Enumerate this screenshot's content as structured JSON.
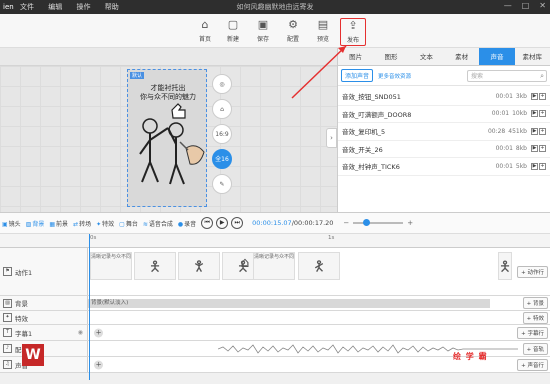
{
  "titlebar": {
    "logo": "ien",
    "menu": [
      "文件",
      "编辑",
      "操作",
      "帮助"
    ],
    "title": "如何风趣幽默地由远寄发",
    "controls": [
      "—",
      "□",
      "✕"
    ]
  },
  "toolbar": {
    "buttons": [
      {
        "label": "首页",
        "icon": "home-icon",
        "glyph": "⌂"
      },
      {
        "label": "新建",
        "icon": "new-file-icon",
        "glyph": "▢"
      },
      {
        "label": "保存",
        "icon": "save-icon",
        "glyph": "▣"
      },
      {
        "label": "配置",
        "icon": "settings-icon",
        "glyph": "⚙"
      },
      {
        "label": "预览",
        "icon": "preview-icon",
        "glyph": "▤"
      },
      {
        "label": "发布",
        "icon": "publish-icon",
        "glyph": "⇪"
      }
    ]
  },
  "canvas": {
    "tag": "默认",
    "headline_line1": "才能衬托出",
    "headline_line2": "你与众不同的魅力",
    "side_tools": [
      "◎",
      "⌂",
      "16:9",
      "全16",
      "✎"
    ]
  },
  "right_panel": {
    "tabs": [
      "图片",
      "图形",
      "文本",
      "素材",
      "声音",
      "素材库"
    ],
    "active_tab": 4,
    "add_label": "添加声音",
    "more_label": "更多音效资源",
    "search_placeholder": "搜索",
    "items": [
      {
        "name": "音效_按钮_SND051",
        "duration": "00:01",
        "size": "3kb"
      },
      {
        "name": "音效_叮满额声_DOOR8",
        "duration": "00:01",
        "size": "10kb"
      },
      {
        "name": "音效_复印机_5",
        "duration": "00:28",
        "size": "451kb"
      },
      {
        "name": "音效_开关_26",
        "duration": "00:01",
        "size": "8kb"
      },
      {
        "name": "音效_村钟声_TICK6",
        "duration": "00:01",
        "size": "5kb"
      }
    ]
  },
  "timeline_toolbar": {
    "tools": [
      {
        "label": "镜头",
        "glyph": "▣"
      },
      {
        "label": "背景",
        "glyph": "▨"
      },
      {
        "label": "前景",
        "glyph": "▦"
      },
      {
        "label": "转场",
        "glyph": "⇄"
      },
      {
        "label": "特效",
        "glyph": "✦"
      },
      {
        "label": "舞台",
        "glyph": "▢"
      },
      {
        "label": "语音合成",
        "glyph": "≋"
      },
      {
        "label": "录音",
        "glyph": "●"
      }
    ],
    "current_time": "00:00:15.07",
    "separator": "/",
    "total_time": "00:00:17.20"
  },
  "ruler": {
    "start": "0s",
    "mark": "1s"
  },
  "tracks": [
    {
      "name": "动作1",
      "glyph": "⚑",
      "add_label": "动作行"
    },
    {
      "name": "背景",
      "glyph": "▨",
      "bar": "背景(默认淡入)",
      "add_label": "背景"
    },
    {
      "name": "特效",
      "glyph": "✦",
      "add_label": "特效"
    },
    {
      "name": "字幕1",
      "glyph": "T",
      "add_label": "字幕行"
    },
    {
      "name": "配音",
      "glyph": "♪",
      "add_label": "音轨"
    },
    {
      "name": "声音",
      "glyph": "♫",
      "add_label": "声音行"
    }
  ],
  "clip_note": "清晰记录与众不同",
  "watermark": "绘 学 霸",
  "app_logo": "W"
}
